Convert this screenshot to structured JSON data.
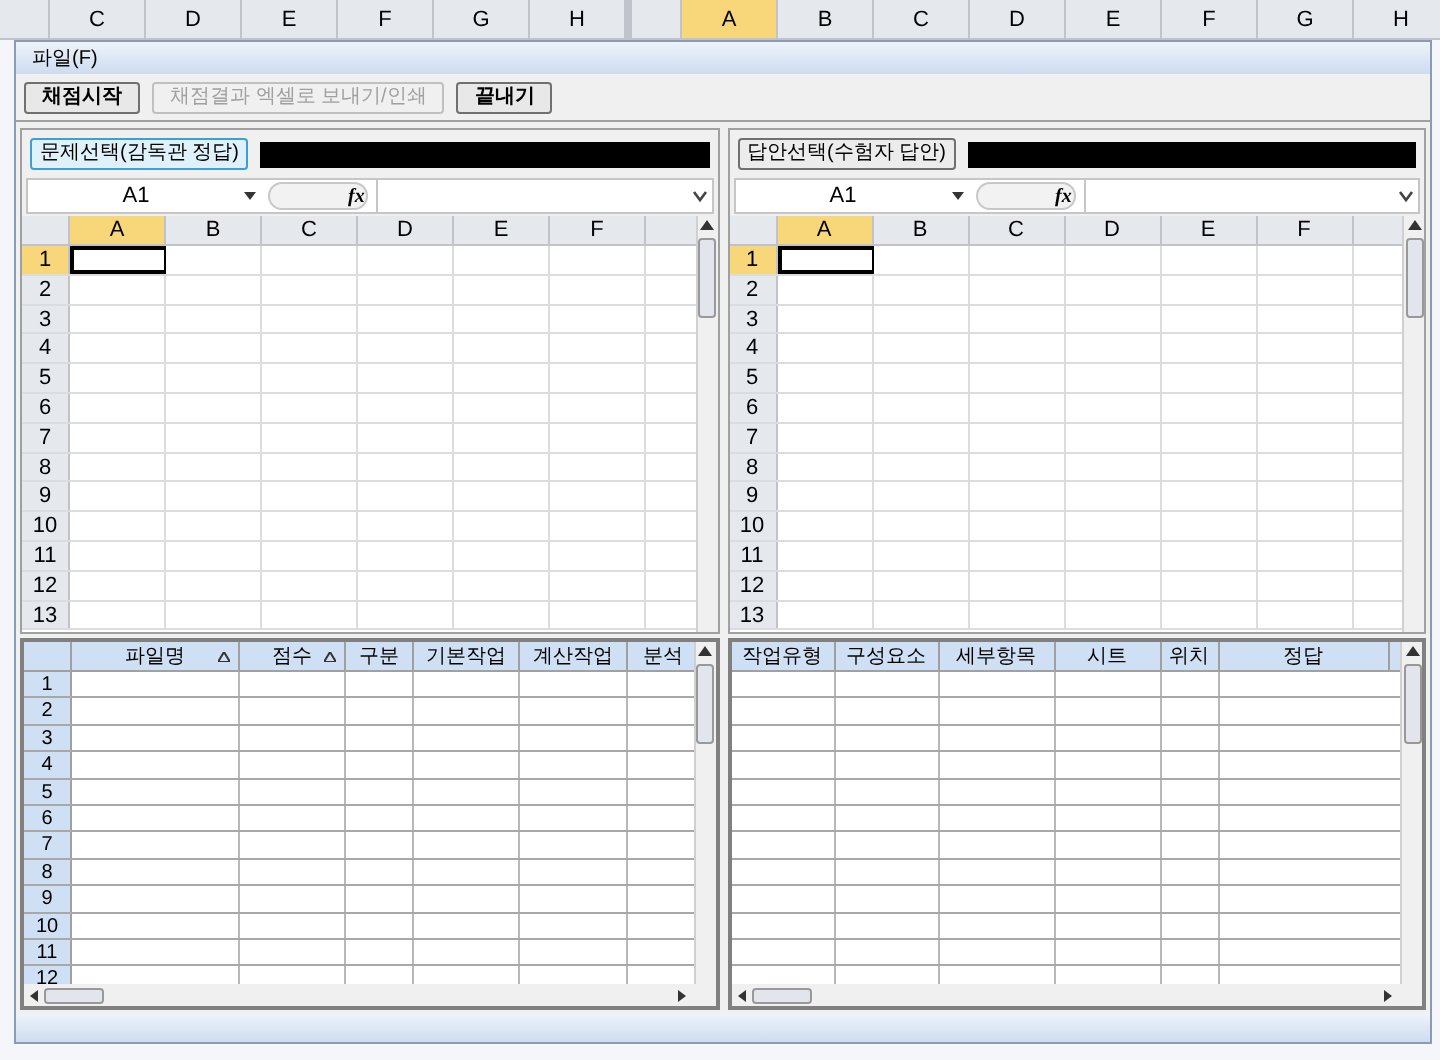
{
  "background_sheet": {
    "left_columns": [
      "C",
      "D",
      "E",
      "F",
      "G",
      "H"
    ],
    "right_columns": [
      {
        "label": "A",
        "selected": true
      },
      {
        "label": "B",
        "selected": false
      },
      {
        "label": "C",
        "selected": false
      },
      {
        "label": "D",
        "selected": false
      },
      {
        "label": "E",
        "selected": false
      },
      {
        "label": "F",
        "selected": false
      },
      {
        "label": "G",
        "selected": false
      },
      {
        "label": "H",
        "selected": false
      }
    ]
  },
  "menu": [
    "파일(F)"
  ],
  "toolbar": [
    {
      "label": "채점시작",
      "disabled": false
    },
    {
      "label": "채점결과 엑셀로 보내기/인쇄",
      "disabled": true
    },
    {
      "label": "끝내기",
      "disabled": false
    }
  ],
  "panes": [
    {
      "button": "문제선택(감독관 정답)",
      "button_focused": true,
      "name_box": "A1",
      "fx": "fx",
      "columns": [
        {
          "label": "A",
          "selected": true
        },
        {
          "label": "B",
          "selected": false
        },
        {
          "label": "C",
          "selected": false
        },
        {
          "label": "D",
          "selected": false
        },
        {
          "label": "E",
          "selected": false
        },
        {
          "label": "F",
          "selected": false
        }
      ],
      "rows": [
        {
          "label": "1",
          "selected": true
        },
        {
          "label": "2",
          "selected": false
        },
        {
          "label": "3",
          "selected": false
        },
        {
          "label": "4",
          "selected": false
        },
        {
          "label": "5",
          "selected": false
        },
        {
          "label": "6",
          "selected": false
        },
        {
          "label": "7",
          "selected": false
        },
        {
          "label": "8",
          "selected": false
        },
        {
          "label": "9",
          "selected": false
        },
        {
          "label": "10",
          "selected": false
        },
        {
          "label": "11",
          "selected": false
        },
        {
          "label": "12",
          "selected": false
        },
        {
          "label": "13",
          "selected": false
        }
      ]
    },
    {
      "button": "답안선택(수험자 답안)",
      "button_focused": false,
      "name_box": "A1",
      "fx": "fx",
      "columns": [
        {
          "label": "A",
          "selected": true
        },
        {
          "label": "B",
          "selected": false
        },
        {
          "label": "C",
          "selected": false
        },
        {
          "label": "D",
          "selected": false
        },
        {
          "label": "E",
          "selected": false
        },
        {
          "label": "F",
          "selected": false
        }
      ],
      "rows": [
        {
          "label": "1",
          "selected": true
        },
        {
          "label": "2",
          "selected": false
        },
        {
          "label": "3",
          "selected": false
        },
        {
          "label": "4",
          "selected": false
        },
        {
          "label": "5",
          "selected": false
        },
        {
          "label": "6",
          "selected": false
        },
        {
          "label": "7",
          "selected": false
        },
        {
          "label": "8",
          "selected": false
        },
        {
          "label": "9",
          "selected": false
        },
        {
          "label": "10",
          "selected": false
        },
        {
          "label": "11",
          "selected": false
        },
        {
          "label": "12",
          "selected": false
        },
        {
          "label": "13",
          "selected": false
        }
      ]
    }
  ],
  "results_grid": {
    "columns": [
      {
        "label": "파일명",
        "sortable": true
      },
      {
        "label": "점수",
        "sortable": true
      },
      {
        "label": "구분"
      },
      {
        "label": "기본작업"
      },
      {
        "label": "계산작업"
      },
      {
        "label": "분석"
      }
    ],
    "row_numbers": [
      "1",
      "2",
      "3",
      "4",
      "5",
      "6",
      "7",
      "8",
      "9",
      "10",
      "11",
      "12"
    ]
  },
  "detail_grid": {
    "columns": [
      {
        "label": "작업유형"
      },
      {
        "label": "구성요소"
      },
      {
        "label": "세부항목"
      },
      {
        "label": "시트"
      },
      {
        "label": "위치"
      },
      {
        "label": "정답"
      }
    ]
  }
}
